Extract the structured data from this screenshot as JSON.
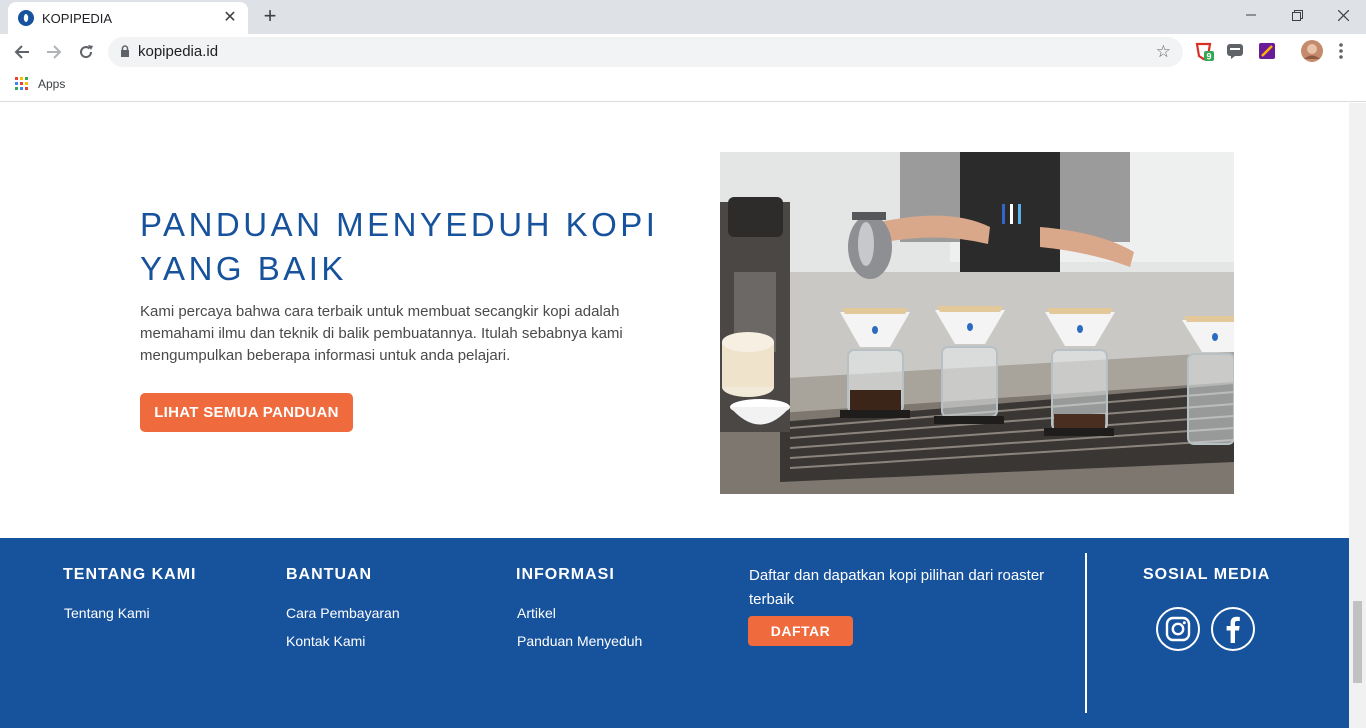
{
  "browser": {
    "tab_title": "KOPIPEDIA",
    "tab_close": "✕",
    "new_tab": "+",
    "url": "kopipedia.id",
    "bookmarks_apps": "Apps",
    "extension_badge": "9"
  },
  "hero": {
    "title_line1": "PANDUAN MENYEDUH KOPI",
    "title_line2": "YANG BAIK",
    "description": "Kami percaya bahwa cara terbaik untuk membuat secangkir kopi adalah memahami ilmu dan teknik di balik pembuatannya. Itulah sebabnya kami mengumpulkan beberapa informasi untuk anda pelajari.",
    "button_label": "LIHAT SEMUA PANDUAN",
    "image_icon": "barista-pour-over-photo"
  },
  "footer": {
    "about": {
      "heading": "TENTANG KAMI",
      "links": [
        "Tentang Kami"
      ]
    },
    "help": {
      "heading": "BANTUAN",
      "links": [
        "Cara Pembayaran",
        "Kontak Kami"
      ]
    },
    "info": {
      "heading": "INFORMASI",
      "links": [
        "Artikel",
        "Panduan Menyeduh"
      ]
    },
    "promo": {
      "text": "Daftar dan dapatkan kopi pilihan dari roaster terbaik",
      "button_label": "DAFTAR"
    },
    "social": {
      "heading": "SOSIAL MEDIA",
      "icons": [
        "instagram-icon",
        "facebook-icon"
      ]
    }
  },
  "colors": {
    "brand_blue": "#17529c",
    "accent_orange": "#ef6a3c"
  }
}
